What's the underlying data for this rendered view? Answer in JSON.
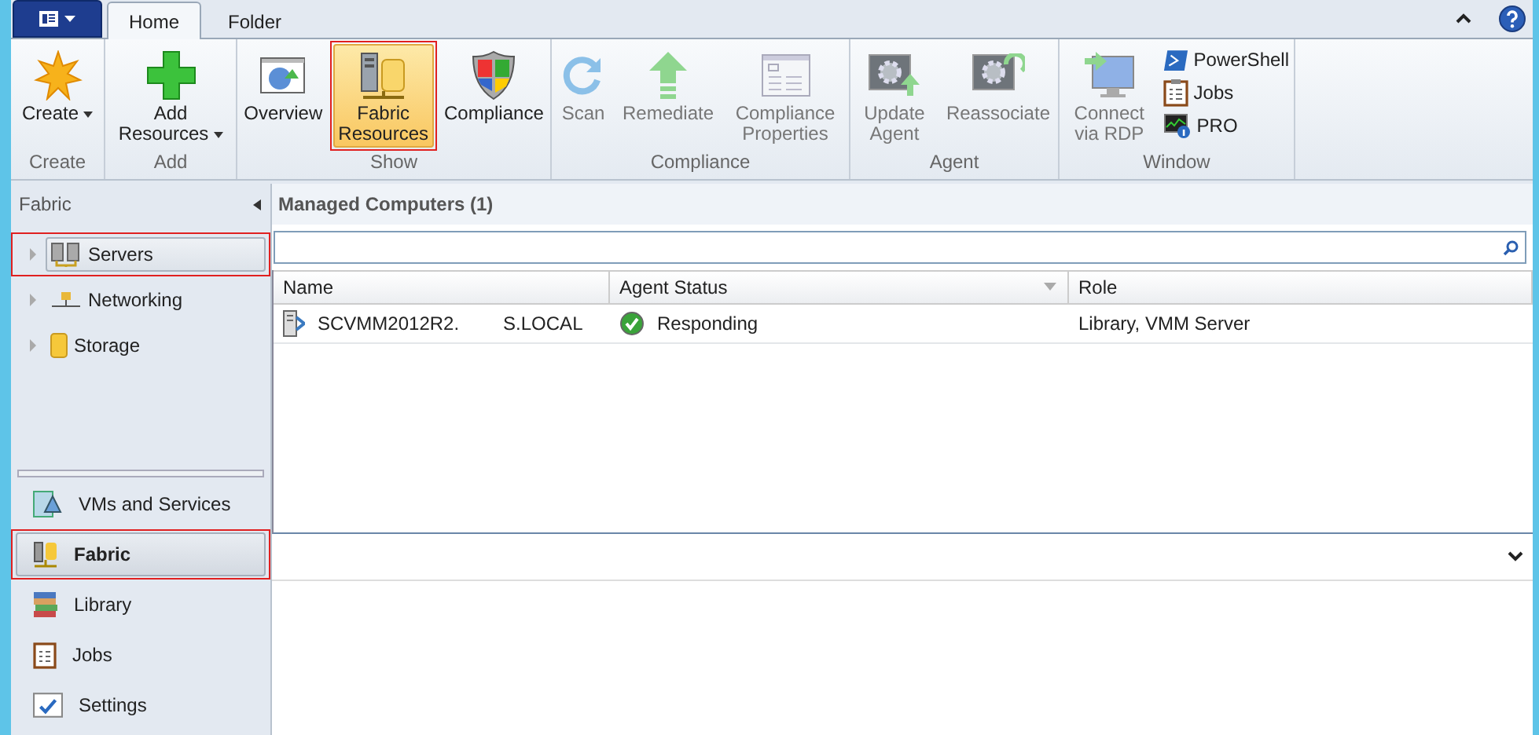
{
  "ribbon": {
    "tabs": [
      {
        "label": "Home",
        "selected": true
      },
      {
        "label": "Folder",
        "selected": false
      }
    ],
    "groups": [
      {
        "label": "Create",
        "buttons": [
          {
            "label": "Create",
            "kind": "large",
            "dropdown": true,
            "disabled": false,
            "selected": false,
            "highlighted": false
          }
        ]
      },
      {
        "label": "Add",
        "buttons": [
          {
            "label": "Add Resources",
            "kind": "large",
            "dropdown": true,
            "disabled": false,
            "selected": false,
            "highlighted": false
          }
        ]
      },
      {
        "label": "Show",
        "buttons": [
          {
            "label": "Overview",
            "kind": "large",
            "dropdown": false,
            "disabled": false,
            "selected": false,
            "highlighted": false
          },
          {
            "label": "Fabric Resources",
            "kind": "large",
            "dropdown": false,
            "disabled": false,
            "selected": true,
            "highlighted": true
          },
          {
            "label": "Compliance",
            "kind": "large",
            "dropdown": false,
            "disabled": false,
            "selected": false,
            "highlighted": false
          }
        ]
      },
      {
        "label": "Compliance",
        "buttons": [
          {
            "label": "Scan",
            "kind": "large",
            "dropdown": false,
            "disabled": true,
            "selected": false,
            "highlighted": false
          },
          {
            "label": "Remediate",
            "kind": "large",
            "dropdown": false,
            "disabled": true,
            "selected": false,
            "highlighted": false
          },
          {
            "label": "Compliance Properties",
            "kind": "large",
            "dropdown": false,
            "disabled": true,
            "selected": false,
            "highlighted": false
          }
        ]
      },
      {
        "label": "Agent",
        "buttons": [
          {
            "label": "Update Agent",
            "kind": "large",
            "dropdown": false,
            "disabled": true,
            "selected": false,
            "highlighted": false
          },
          {
            "label": "Reassociate",
            "kind": "large",
            "dropdown": false,
            "disabled": true,
            "selected": false,
            "highlighted": false
          }
        ]
      },
      {
        "label": "Window",
        "buttons": [
          {
            "label": "Connect via RDP",
            "kind": "large",
            "dropdown": false,
            "disabled": true,
            "selected": false,
            "highlighted": false
          },
          {
            "label": "PowerShell",
            "kind": "small",
            "disabled": false
          },
          {
            "label": "Jobs",
            "kind": "small",
            "disabled": false
          },
          {
            "label": "PRO",
            "kind": "small",
            "disabled": false
          }
        ]
      }
    ]
  },
  "sidebar": {
    "title": "Fabric",
    "tree": [
      {
        "label": "Servers",
        "expanded": false,
        "selected": true,
        "highlighted": true
      },
      {
        "label": "Networking",
        "expanded": false,
        "selected": false,
        "highlighted": false
      },
      {
        "label": "Storage",
        "expanded": false,
        "selected": false,
        "highlighted": false
      }
    ],
    "workspaces": [
      {
        "label": "VMs and Services",
        "selected": false,
        "highlighted": false
      },
      {
        "label": "Fabric",
        "selected": true,
        "highlighted": true
      },
      {
        "label": "Library",
        "selected": false,
        "highlighted": false
      },
      {
        "label": "Jobs",
        "selected": false,
        "highlighted": false
      },
      {
        "label": "Settings",
        "selected": false,
        "highlighted": false
      }
    ]
  },
  "content": {
    "title": "Managed Computers (1)",
    "table": {
      "columns": [
        {
          "label": "Name"
        },
        {
          "label": "Agent Status"
        },
        {
          "label": "Role"
        }
      ],
      "rows": [
        {
          "name": "SCVMM2012R2.",
          "name_suffix": "S.LOCAL",
          "status": "Responding",
          "role": "Library, VMM Server"
        }
      ]
    }
  }
}
